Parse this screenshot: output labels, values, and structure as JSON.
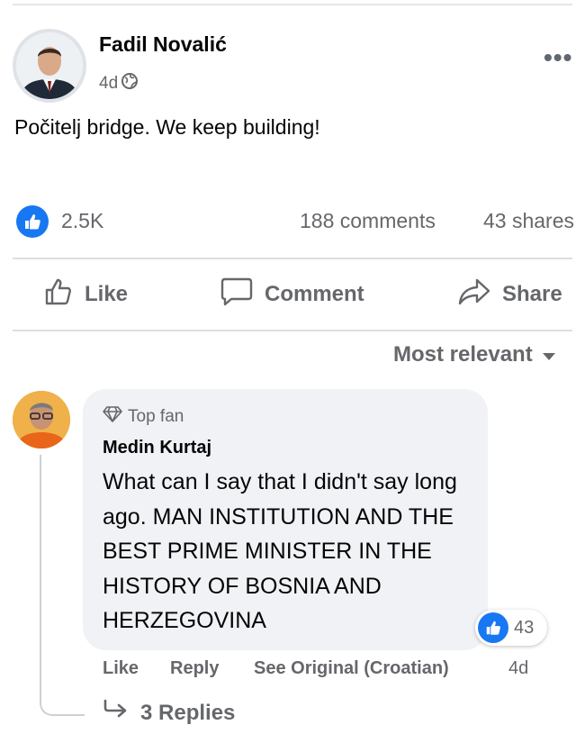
{
  "post": {
    "author": "Fadil Novalić",
    "time": "4d",
    "privacy_icon": "globe-icon",
    "text": "Počitelj bridge. We keep building!",
    "reaction_count": "2.5K",
    "comments": "188 comments",
    "shares": "43 shares"
  },
  "actions": {
    "like": "Like",
    "comment": "Comment",
    "share": "Share"
  },
  "sort": {
    "label": "Most relevant"
  },
  "comment": {
    "badge": "Top fan",
    "author": "Medin Kurtaj",
    "text": "What can I say that I didn't say long ago. MAN INSTITUTION AND THE BEST PRIME MINISTER IN THE HISTORY OF BOSNIA AND HERZEGOVINA",
    "reaction_count": "43",
    "like": "Like",
    "reply": "Reply",
    "see_original": "See Original (Croatian)",
    "time": "4d",
    "replies": "3 Replies"
  },
  "colors": {
    "accent": "#1877f2",
    "secondary_text": "#65676b",
    "bubble": "#f0f2f5"
  }
}
